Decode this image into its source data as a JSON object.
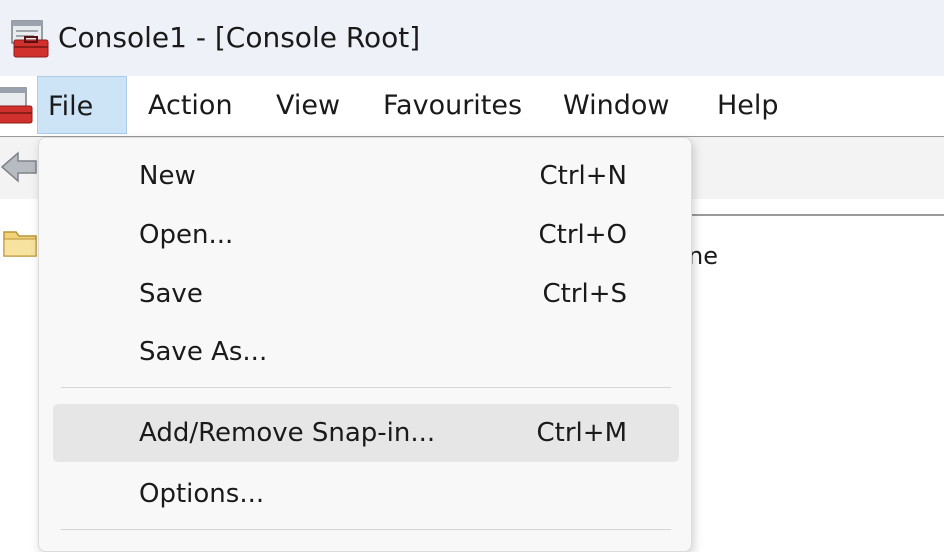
{
  "window": {
    "title": "Console1 - [Console Root]",
    "app_icon": "mmc-toolbox-icon"
  },
  "menubar": {
    "items": [
      {
        "label": "File",
        "active": true
      },
      {
        "label": "Action"
      },
      {
        "label": "View"
      },
      {
        "label": "Favourites"
      },
      {
        "label": "Window"
      },
      {
        "label": "Help"
      }
    ]
  },
  "toolbar": {
    "back_icon": "back-arrow-icon"
  },
  "content": {
    "tree_icon": "folder-icon",
    "column_header_partial": "ne"
  },
  "file_menu": {
    "items": [
      {
        "label": "New",
        "shortcut": "Ctrl+N"
      },
      {
        "label": "Open...",
        "shortcut": "Ctrl+O"
      },
      {
        "label": "Save",
        "shortcut": "Ctrl+S"
      },
      {
        "label": "Save As...",
        "shortcut": ""
      },
      {
        "label": "Add/Remove Snap-in...",
        "shortcut": "Ctrl+M",
        "highlighted": true
      },
      {
        "label": "Options...",
        "shortcut": ""
      }
    ]
  },
  "colors": {
    "titlebar_bg": "#eef1f7",
    "menu_active_bg": "#cde4f7",
    "menu_active_border": "#a9cdea",
    "dropdown_bg": "#f8f8f8",
    "dropdown_hover_bg": "#e6e6e6"
  }
}
